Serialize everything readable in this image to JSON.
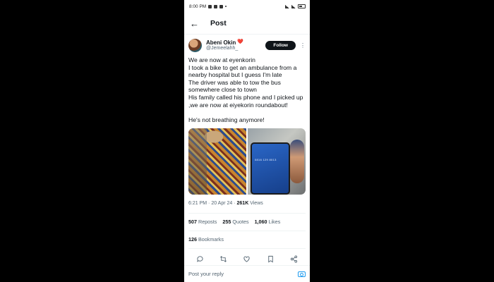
{
  "status_bar": {
    "time": "8:00 PM",
    "right_text": "65"
  },
  "header": {
    "back_icon": "←",
    "title": "Post"
  },
  "author": {
    "display_name": "Abeni Okin",
    "emoji": "❤️",
    "handle": "@Jemeelahh_"
  },
  "follow_label": "Follow",
  "more_icon": "⋮",
  "tweet_text": "We are now at eyenkorin\nI took a bike to get an ambulance from a nearby hospital but I guess I'm late\nThe driver was able to tow the bus somewhere close to town\nHis family called his phone and I picked up ,we are now at eiyekorin roundabout!\n\nHe's not breathing anymore!",
  "photo2_number": "0816 129 8013",
  "meta": {
    "time": "6:21 PM",
    "date": "20 Apr 24",
    "views_count": "261K",
    "views_label": "Views"
  },
  "stats": {
    "reposts_count": "507",
    "reposts_label": "Reposts",
    "quotes_count": "255",
    "quotes_label": "Quotes",
    "likes_count": "1,060",
    "likes_label": "Likes"
  },
  "bookmarks": {
    "count": "126",
    "label": "Bookmarks"
  },
  "actions": {
    "reply_icon": "reply-icon",
    "repost_icon": "repost-icon",
    "like_icon": "heart-icon",
    "bookmark_icon": "bookmark-icon",
    "share_icon": "share-icon"
  },
  "reply": {
    "placeholder": "Post your reply"
  },
  "colors": {
    "accent": "#1d9bf0",
    "text": "#0f1419",
    "muted": "#536471",
    "background": "#000000"
  }
}
